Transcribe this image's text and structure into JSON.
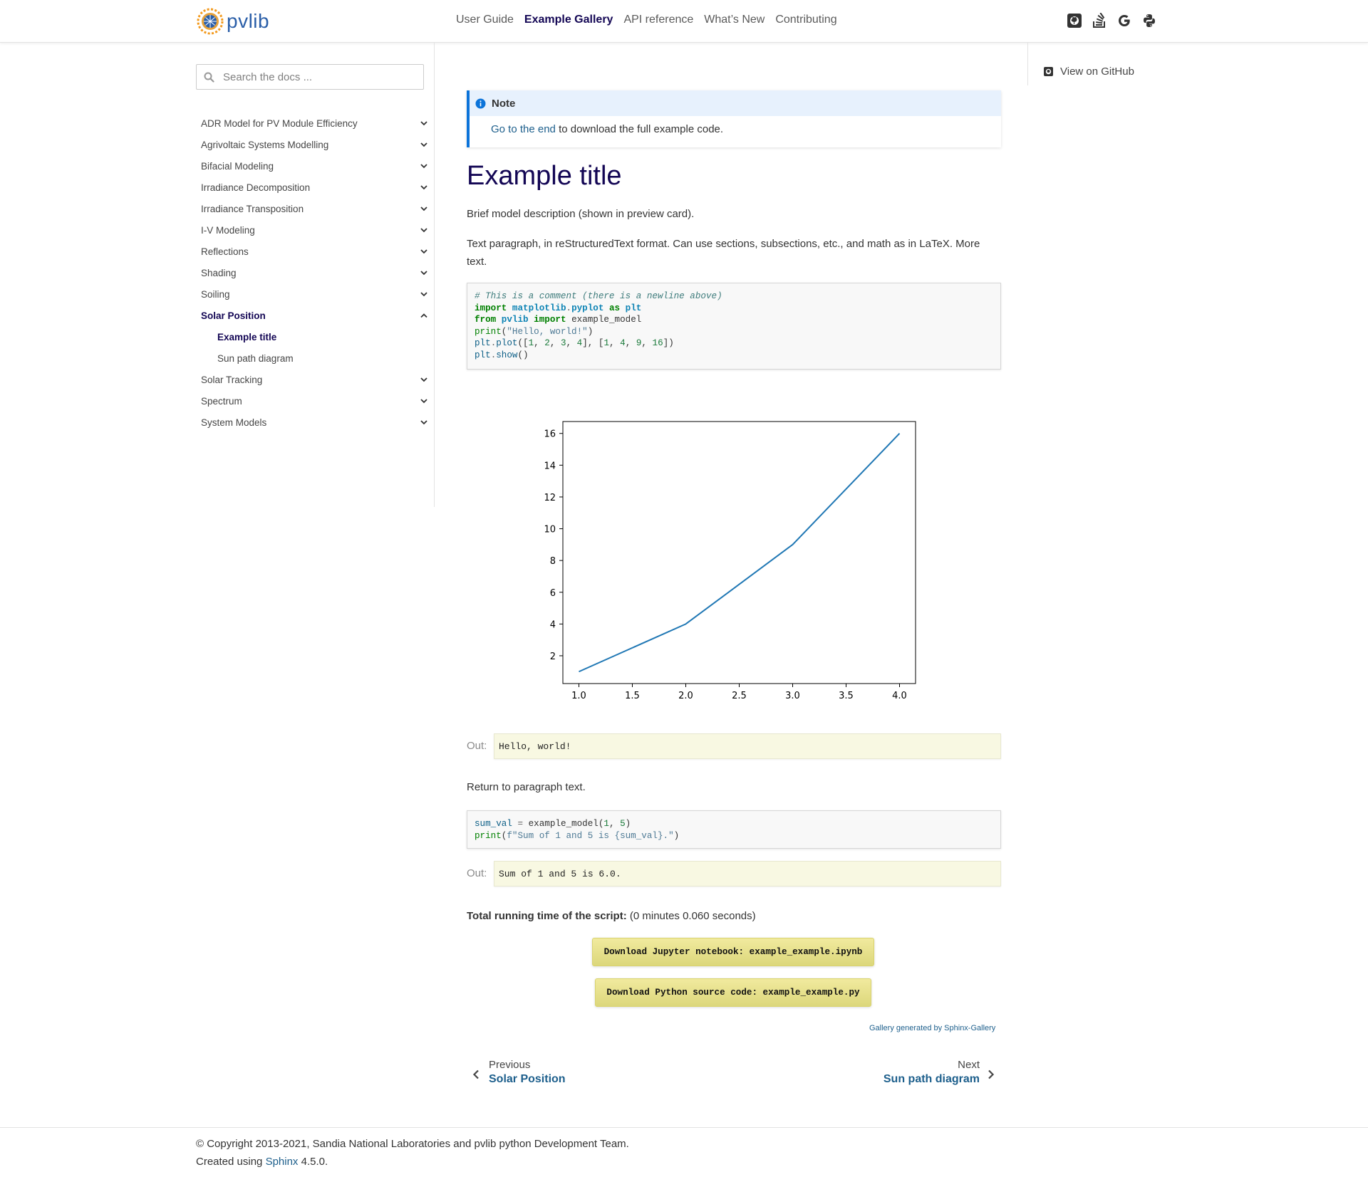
{
  "header": {
    "logo_text": "pvlib",
    "nav": [
      {
        "label": "User Guide"
      },
      {
        "label": "Example Gallery"
      },
      {
        "label": "API reference"
      },
      {
        "label": "What’s New"
      },
      {
        "label": "Contributing"
      }
    ],
    "active_nav": "Example Gallery",
    "icons": [
      "github-icon",
      "stack-overflow-icon",
      "google-icon",
      "python-icon"
    ]
  },
  "sidebar": {
    "search_placeholder": "Search the docs ...",
    "items": [
      {
        "label": "ADR Model for PV Module Efficiency",
        "expanded": false
      },
      {
        "label": "Agrivoltaic Systems Modelling",
        "expanded": false
      },
      {
        "label": "Bifacial Modeling",
        "expanded": false
      },
      {
        "label": "Irradiance Decomposition",
        "expanded": false
      },
      {
        "label": "Irradiance Transposition",
        "expanded": false
      },
      {
        "label": "I-V Modeling",
        "expanded": false
      },
      {
        "label": "Reflections",
        "expanded": false
      },
      {
        "label": "Shading",
        "expanded": false
      },
      {
        "label": "Soiling",
        "expanded": false
      },
      {
        "label": "Solar Position",
        "expanded": true,
        "active": true
      },
      {
        "label": "Example title",
        "sub": true,
        "active": true
      },
      {
        "label": "Sun path diagram",
        "sub": true
      },
      {
        "label": "Solar Tracking",
        "expanded": false
      },
      {
        "label": "Spectrum",
        "expanded": false
      },
      {
        "label": "System Models",
        "expanded": false
      }
    ]
  },
  "right_sidebar": {
    "github_link": "View on GitHub"
  },
  "note": {
    "heading": "Note",
    "link_text": "Go to the end",
    "rest_text": " to download the full example code."
  },
  "content": {
    "title": "Example title",
    "description": "Brief model description (shown in preview card).",
    "paragraph": "Text paragraph, in reStructuredText format. Can use sections, subsections, etc., and math as in LaTeX. More text.",
    "code1_lines": [
      "# This is a comment (there is a newline above)",
      "import matplotlib.pyplot as plt",
      "from pvlib import example_model",
      "print(\"Hello, world!\")",
      "plt.plot([1, 2, 3, 4], [1, 4, 9, 16])",
      "plt.show()"
    ],
    "out_label": "Out:",
    "out1": "Hello, world!",
    "return_text": "Return to paragraph text.",
    "code2_lines": [
      "sum_val = example_model(1, 5)",
      "print(f\"Sum of 1 and 5 is {sum_val}.\")"
    ],
    "out2": "Sum of 1 and 5 is 6.0.",
    "running_time_label": "Total running time of the script:",
    "running_time_value": " (0 minutes 0.060 seconds)",
    "download_notebook": "Download Jupyter notebook: example_example.ipynb",
    "download_python": "Download Python source code: example_example.py",
    "gallery_credit": "Gallery generated by Sphinx-Gallery"
  },
  "chart_data": {
    "type": "line",
    "x": [
      1,
      2,
      3,
      4
    ],
    "series": [
      {
        "values": [
          1,
          4,
          9,
          16
        ],
        "color": "#1f77b4"
      }
    ],
    "xlim": [
      0.85,
      4.15
    ],
    "ylim": [
      0.25,
      16.75
    ],
    "xticks": [
      "1.0",
      "1.5",
      "2.0",
      "2.5",
      "3.0",
      "3.5",
      "4.0"
    ],
    "yticks": [
      "2",
      "4",
      "6",
      "8",
      "10",
      "12",
      "14",
      "16"
    ],
    "grid": false
  },
  "prevnext": {
    "prev_label": "Previous",
    "prev_title": "Solar Position",
    "next_label": "Next",
    "next_title": "Sun path diagram"
  },
  "footer": {
    "copyright": "© Copyright 2013-2021, Sandia National Laboratories and pvlib python Development Team.",
    "created_prefix": "Created using ",
    "sphinx_link": "Sphinx",
    "created_suffix": " 4.5.0."
  },
  "colors": {
    "accent": "#130654",
    "link": "#1d5f8c",
    "note_border": "#0b73d9",
    "line": "#1f77b4"
  }
}
